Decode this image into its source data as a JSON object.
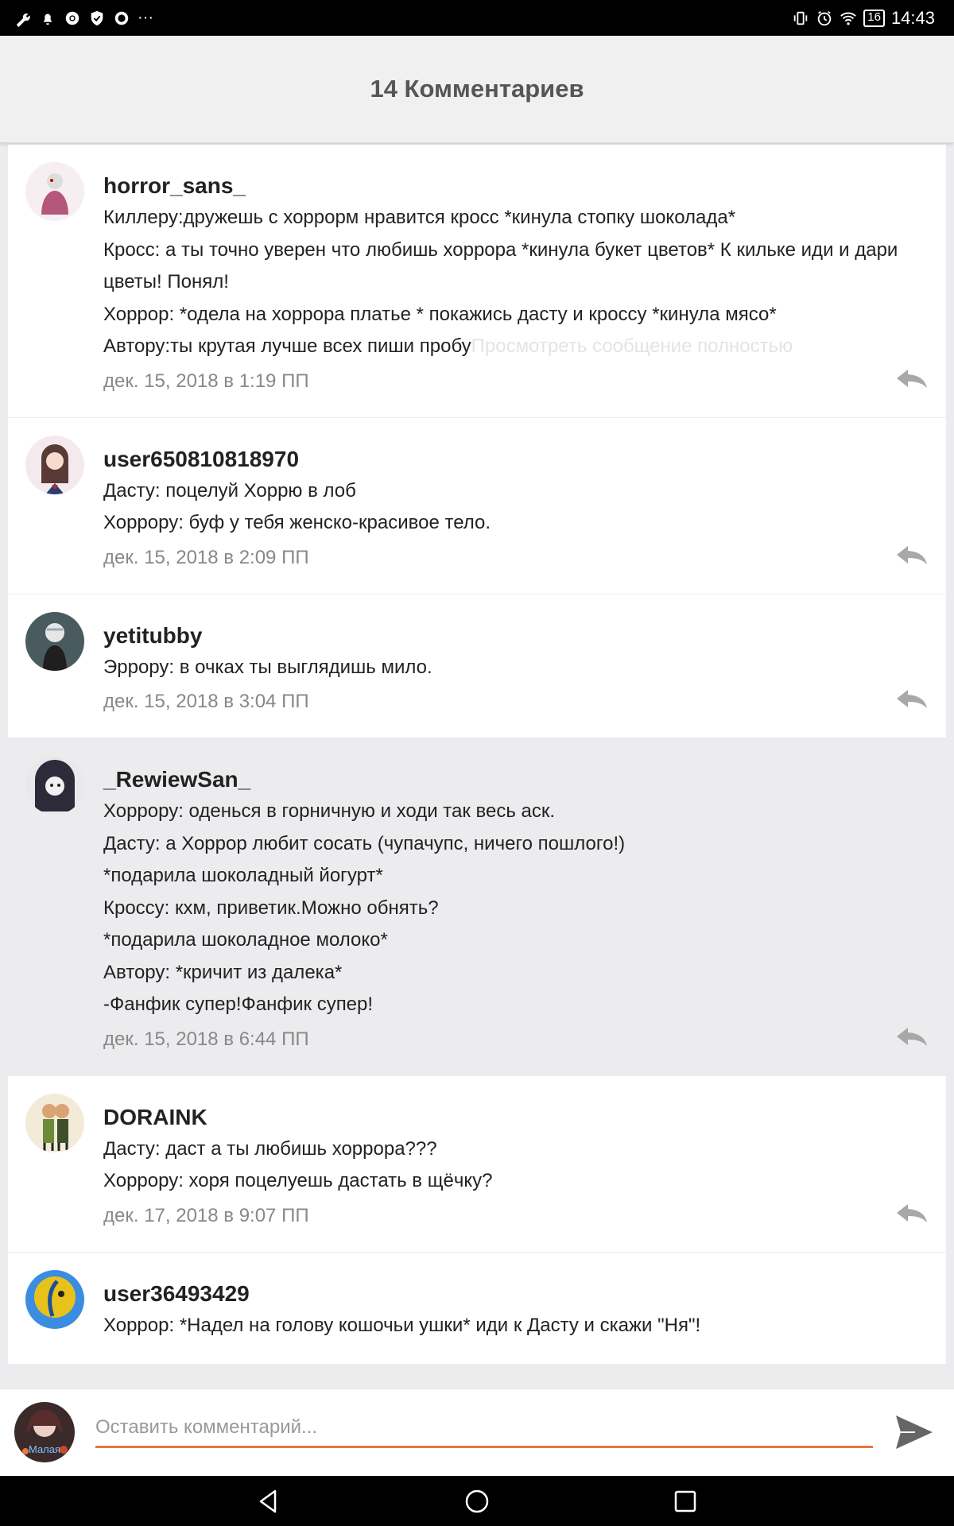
{
  "status_bar": {
    "time": "14:43",
    "battery": "16",
    "more": "···"
  },
  "header": {
    "title": "14 Комментариев"
  },
  "comments": [
    {
      "user": "horror_sans_",
      "lines": "Киллеру:дружешь с хоррорм нравится кросс *кинула стопку шоколада*\nКросс: а ты точно уверен что любишь хоррора *кинула букет цветов* К кильке иди и дари цветы! Понял!\nХоррор: *одела на хоррора платье * покажись дасту и кроссу *кинула мясо*\nАвтору:ты крутая лучше всех пиши пробу",
      "more": "Просмотреть сообщение полностью",
      "date": "дек. 15, 2018 в 1:19 ПП",
      "avatar": "#b5577a"
    },
    {
      "user": "user650810818970",
      "lines": "Дасту: поцелуй Хоррю в лоб\nХоррору: буф у тебя женско-красивое тело.",
      "date": "дек. 15, 2018 в 2:09 ПП",
      "avatar": "#5a3a36"
    },
    {
      "user": "yetitubby",
      "lines": "Эррору: в очках ты выглядишь мило.",
      "date": "дек. 15, 2018 в 3:04 ПП",
      "avatar": "#4a5b60"
    },
    {
      "user": "_RewiewSan_",
      "lines": "Хоррору: оденься в горничную и ходи так весь аск.\nДасту: а Хоррор любит сосать (чупачупс, ничего пошлого!)\n*подарила шоколадный йогурт*\nКроссу: кхм, приветик.Можно обнять?\n*подарила шоколадное молоко*\nАвтору: *кричит из далека*\n-Фанфик супер!Фанфик супер!",
      "date": "дек. 15, 2018 в 6:44 ПП",
      "avatar": "#2d2a3a"
    },
    {
      "user": "DORAINK",
      "lines": "Дасту: даст а ты любишь хоррора???\nХоррору: хоря поцелуешь дастать в щёчку?",
      "date": "дек. 17, 2018 в 9:07 ПП",
      "avatar": "#6d8a3a"
    },
    {
      "user": "user36493429",
      "lines": "Хоррор: *Надел на голову кошочьи ушки* иди к Дасту и скажи \"Ня\"!",
      "date": "",
      "avatar": "#e8c21a"
    }
  ],
  "composer": {
    "placeholder": "Оставить комментарий...",
    "avatar_label": "Малая"
  },
  "colors": {
    "accent": "#e8783c",
    "send": "#666666"
  }
}
